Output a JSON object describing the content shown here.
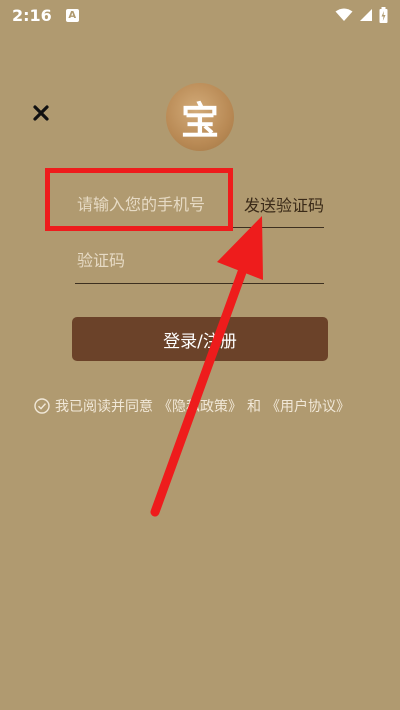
{
  "status_bar": {
    "time": "2:16",
    "notification_icon_text": "A",
    "icons": [
      "wifi-icon",
      "signal-icon",
      "battery-icon"
    ]
  },
  "login": {
    "phone_placeholder": "请输入您的手机号",
    "send_code_label": "发送验证码",
    "code_placeholder": "验证码",
    "submit_label": "登录/注册",
    "logo_char": "宝"
  },
  "agreement": {
    "prefix": "我已阅读并同意",
    "privacy_link": "《隐私政策》",
    "conjunction": "和",
    "terms_link": "《用户协议》"
  },
  "colors": {
    "background": "#b09a70",
    "button": "#6b4229",
    "annotation": "#ee1c1c"
  }
}
